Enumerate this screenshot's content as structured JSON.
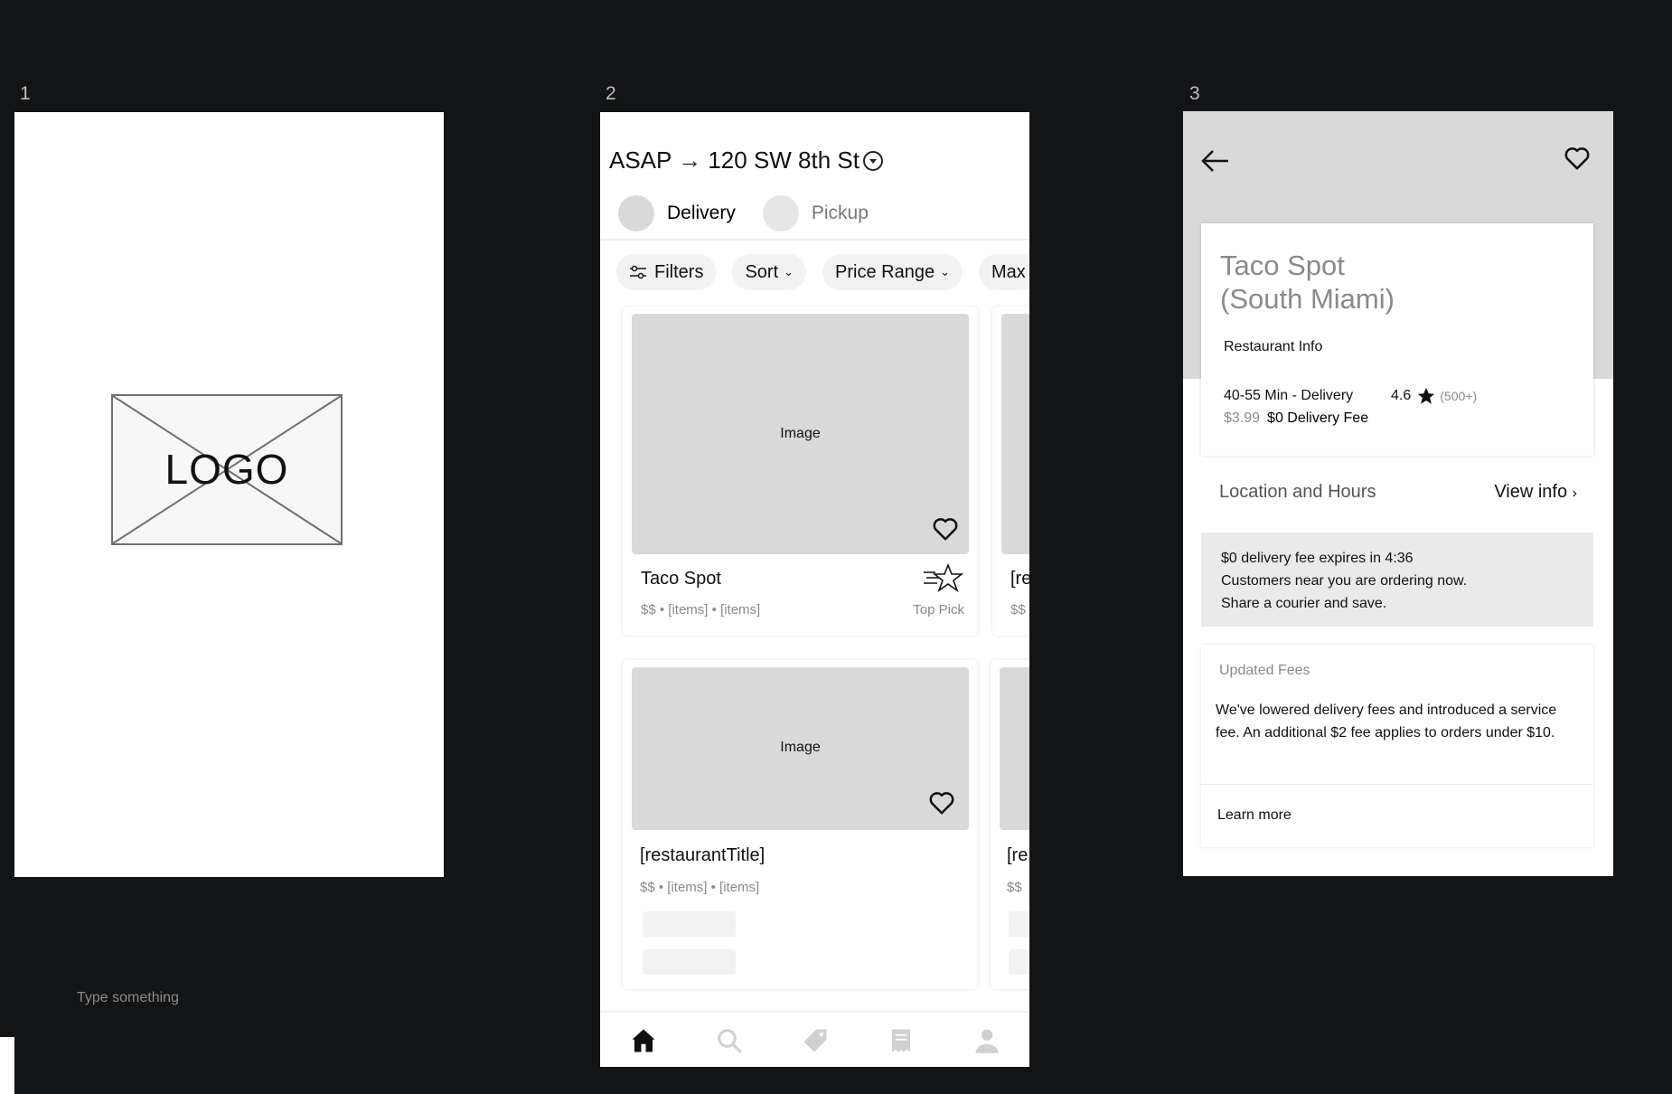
{
  "frames": {
    "one": {
      "number": "1",
      "logo_text": "LOGO"
    },
    "two": {
      "number": "2"
    },
    "three": {
      "number": "3"
    }
  },
  "canvas_note": "Type something",
  "feed": {
    "address": "ASAP → 120 SW 8th St",
    "modes": [
      {
        "label": "Delivery"
      },
      {
        "label": "Pickup"
      }
    ],
    "chips": [
      {
        "label": "Filters",
        "icon": "sliders-icon"
      },
      {
        "label": "Sort"
      },
      {
        "label": "Price Range"
      },
      {
        "label": "Max"
      }
    ],
    "cards": [
      {
        "image_label": "Image",
        "title": "Taco Spot",
        "meta": "$$ • [items] • [items]",
        "badge": "Top Pick"
      },
      {
        "title": "[re",
        "meta": "$$"
      },
      {
        "image_label": "Image",
        "title": "[restaurantTitle]",
        "meta": "$$ • [items] • [items]"
      },
      {
        "title": "[re",
        "meta": "$$"
      }
    ],
    "bottom_nav": [
      "home-icon",
      "search-icon",
      "tag-icon",
      "receipt-icon",
      "account-icon"
    ]
  },
  "store": {
    "name_line1": "Taco Spot",
    "name_line2": "(South Miami)",
    "info_label": "Restaurant Info",
    "eta": "40-55 Min - Delivery",
    "rating": "4.6",
    "rating_count": "(500+)",
    "old_fee": "$3.99",
    "fee": "$0 Delivery Fee",
    "location_label": "Location and Hours",
    "view_info": "View info",
    "promo_lines": [
      "$0 delivery fee expires in 4:36",
      "Customers near you are ordering now.",
      "Share a courier and save."
    ],
    "fees_title": "Updated Fees",
    "fees_body": "We've lowered delivery fees and introduced a service fee. An additional $2 fee applies to orders under $10.",
    "learn_more": "Learn more"
  }
}
